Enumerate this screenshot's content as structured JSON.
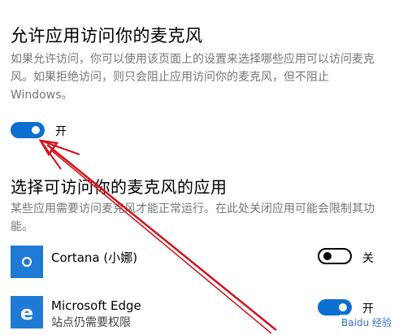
{
  "section1": {
    "title": "允许应用访问你的麦克风",
    "description": "如果允许访问，你可以使用该页面上的设置来选择哪些应用可以访问麦克风。如果拒绝访问，则只会阻止应用访问你的麦克风，但不阻止 Windows。",
    "toggle_state_label": "开"
  },
  "section2": {
    "title": "选择可访问你的麦克风的应用",
    "description": "某些应用需要访问麦克风才能正常运行。在此处关闭应用可能会限制其功能。"
  },
  "apps": [
    {
      "name": "Cortana (小娜)",
      "subtitle": "",
      "toggle_label": "关",
      "on": false
    },
    {
      "name": "Microsoft Edge",
      "subtitle": "站点仍需要权限",
      "toggle_label": "开",
      "on": true
    }
  ],
  "colors": {
    "accent": "#0a6fd1",
    "arrow": "#d0141c",
    "tile": "#1f7ad6"
  },
  "icons": [
    "cortana-icon",
    "edge-icon"
  ],
  "watermark": "Baidu 经验"
}
